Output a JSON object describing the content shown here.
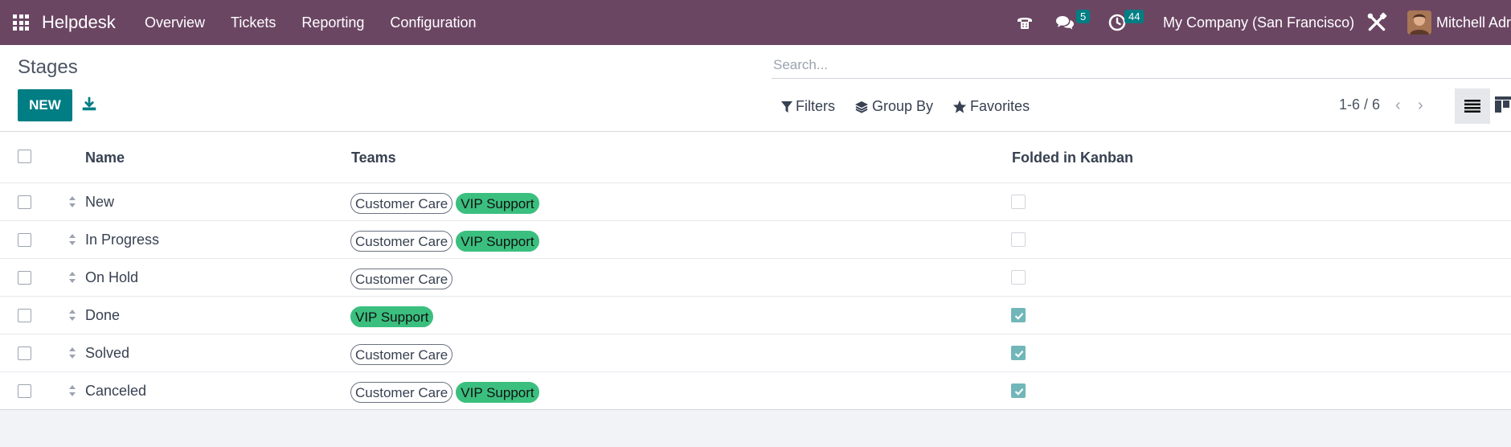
{
  "navbar": {
    "brand": "Helpdesk",
    "menu": [
      "Overview",
      "Tickets",
      "Reporting",
      "Configuration"
    ],
    "messages_count": "5",
    "activities_count": "44",
    "company": "My Company (San Francisco)",
    "user": "Mitchell Adr"
  },
  "control_panel": {
    "title": "Stages",
    "new_label": "NEW",
    "search_placeholder": "Search...",
    "filters_label": "Filters",
    "group_by_label": "Group By",
    "favorites_label": "Favorites",
    "pager": "1-6 / 6"
  },
  "table": {
    "columns": {
      "name": "Name",
      "teams": "Teams",
      "folded": "Folded in Kanban"
    },
    "rows": [
      {
        "name": "New",
        "teams": [
          {
            "label": "Customer Care",
            "style": "outline"
          },
          {
            "label": "VIP Support",
            "style": "green"
          }
        ],
        "folded": false
      },
      {
        "name": "In Progress",
        "teams": [
          {
            "label": "Customer Care",
            "style": "outline"
          },
          {
            "label": "VIP Support",
            "style": "green"
          }
        ],
        "folded": false
      },
      {
        "name": "On Hold",
        "teams": [
          {
            "label": "Customer Care",
            "style": "outline"
          }
        ],
        "folded": false
      },
      {
        "name": "Done",
        "teams": [
          {
            "label": "VIP Support",
            "style": "green"
          }
        ],
        "folded": true
      },
      {
        "name": "Solved",
        "teams": [
          {
            "label": "Customer Care",
            "style": "outline"
          }
        ],
        "folded": true
      },
      {
        "name": "Canceled",
        "teams": [
          {
            "label": "Customer Care",
            "style": "outline"
          },
          {
            "label": "VIP Support",
            "style": "green"
          }
        ],
        "folded": true
      }
    ]
  },
  "colors": {
    "navbar": "#6b4663",
    "primary": "#017e84",
    "tag_green": "#3bbf7f",
    "checked": "#71b6b9"
  }
}
